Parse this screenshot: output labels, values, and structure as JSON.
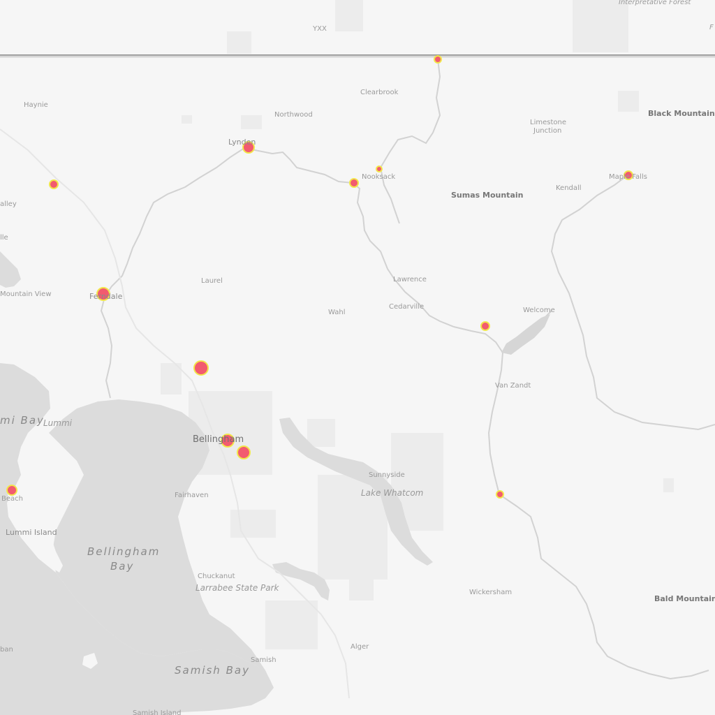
{
  "map": {
    "labels": {
      "yxx": "YXX",
      "interpretive_forest": "Interpretative Forest",
      "clearbrook": "Clearbrook",
      "haynie": "Haynie",
      "northwood": "Northwood",
      "lynden": "Lynden",
      "limestone_junction_1": "Limestone",
      "limestone_junction_2": "Junction",
      "black_mountain": "Black Mountain",
      "nooksack": "Nooksack",
      "sumas_mountain": "Sumas Mountain",
      "kendall": "Kendall",
      "maple_falls": "Maple Falls",
      "valley": "alley",
      "lle": "lle",
      "mountain_view": "Mountain View",
      "ferndale": "Ferndale",
      "laurel": "Laurel",
      "lawrence": "Lawrence",
      "cedarville": "Cedarville",
      "wahl": "Wahl",
      "welcome": "Welcome",
      "van_zandt": "Van Zandt",
      "lummi_bay": "mi Bay",
      "lummi": "Lummi",
      "bellingham": "Bellingham",
      "sunnyside": "Sunnyside",
      "lake_whatcom": "Lake Whatcom",
      "beach": "Beach",
      "fairhaven": "Fairhaven",
      "lummi_island": "Lummi Island",
      "bellingham_bay_1": "Bellingham",
      "bellingham_bay_2": "Bay",
      "chuckanut": "Chuckanut",
      "larrabee": "Larrabee State Park",
      "wickersham": "Wickersham",
      "bald_mountain": "Bald Mountain",
      "alger": "Alger",
      "samish": "Samish",
      "samish_bay": "Samish Bay",
      "samish_island": "Samish Island",
      "ban": "ban",
      "f": "F"
    },
    "colors": {
      "land": "#f6f6f6",
      "water": "#dcdcdc",
      "marker_fill": "#f25b6f",
      "marker_halo": "#f2e64a",
      "river": "#d0d0d0",
      "border": "#9a9a9a"
    }
  }
}
